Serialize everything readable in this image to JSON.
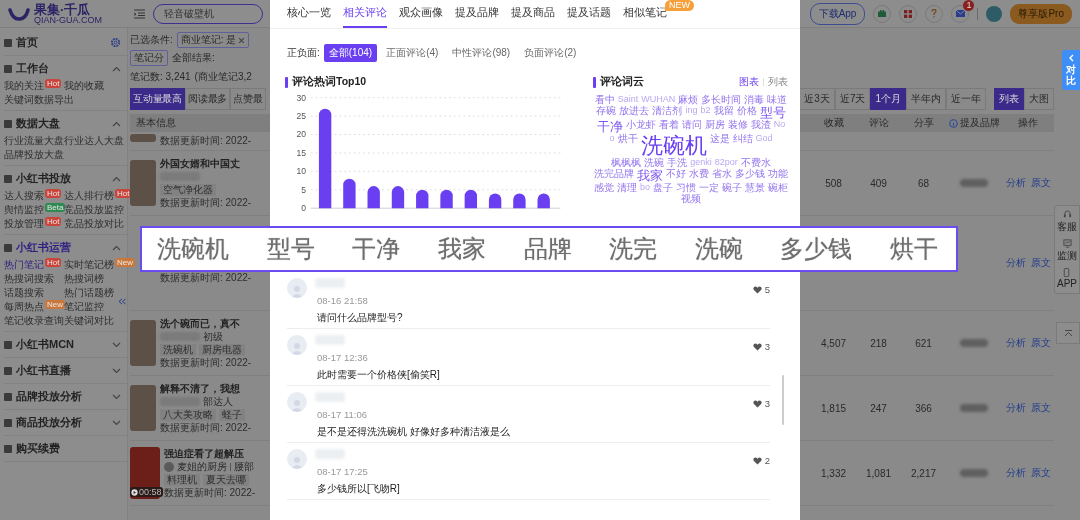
{
  "header": {
    "logo": "果集·千瓜",
    "logo_sub": "QIAN-GUA.COM",
    "search": {
      "placeholder": "轻音破壁机"
    },
    "download": "下载App",
    "message_badge": "1",
    "plan": "尊享版Pro"
  },
  "sidebar": {
    "sections": [
      {
        "label": "首页",
        "kind": "link",
        "selected": false
      },
      {
        "label": "工作台",
        "kind": "group",
        "selected": false,
        "expanded": true,
        "items": [
          {
            "label": "我的关注",
            "selected": false,
            "badge": {
              "text": "Hot",
              "color": "#c9443a"
            }
          },
          {
            "label": "我的收藏",
            "selected": false
          },
          {
            "label": "关键词数据导出",
            "selected": false
          }
        ]
      },
      {
        "label": "数据大盘",
        "kind": "group",
        "selected": false,
        "expanded": true,
        "items": [
          {
            "label": "行业流量大盘",
            "selected": false
          },
          {
            "label": "行业达人大盘",
            "selected": false
          },
          {
            "label": "品牌投放大盘",
            "selected": false
          }
        ]
      },
      {
        "label": "小红书投放",
        "kind": "group",
        "selected": false,
        "expanded": true,
        "items": [
          {
            "label": "达人搜索",
            "selected": false,
            "badge": {
              "text": "Hot",
              "color": "#c9443a"
            }
          },
          {
            "label": "达人排行榜",
            "selected": false,
            "badge": {
              "text": "Hot",
              "color": "#c9443a"
            }
          },
          {
            "label": "舆情监控",
            "selected": false,
            "badge": {
              "text": "Beta",
              "color": "#2f8a52"
            }
          },
          {
            "label": "竞品投放监控",
            "selected": false
          },
          {
            "label": "投放管理",
            "selected": false,
            "badge": {
              "text": "Hot",
              "color": "#c9443a"
            }
          },
          {
            "label": "竞品投放对比",
            "selected": false
          }
        ]
      },
      {
        "label": "小红书运营",
        "kind": "group",
        "selected": true,
        "expanded": true,
        "items": [
          {
            "label": "热门笔记",
            "selected": true,
            "badge": {
              "text": "Hot",
              "color": "#c9443a"
            }
          },
          {
            "label": "实时笔记榜",
            "selected": false,
            "badge": {
              "text": "New",
              "color": "#c9773a"
            }
          },
          {
            "label": "热搜词搜索",
            "selected": false
          },
          {
            "label": "热搜词榜",
            "selected": false
          },
          {
            "label": "话题搜索",
            "selected": false
          },
          {
            "label": "热门话题榜",
            "selected": false
          },
          {
            "label": "每周热点",
            "selected": false,
            "badge": {
              "text": "New",
              "color": "#c9773a"
            }
          },
          {
            "label": "笔记监控",
            "selected": false
          },
          {
            "label": "笔记收录查询",
            "selected": false
          },
          {
            "label": "关键词对比",
            "selected": false
          }
        ]
      },
      {
        "label": "小红书MCN",
        "kind": "group",
        "selected": false,
        "expanded": false
      },
      {
        "label": "小红书直播",
        "kind": "group",
        "selected": false,
        "expanded": false
      },
      {
        "label": "品牌投放分析",
        "kind": "group",
        "selected": false,
        "expanded": false
      },
      {
        "label": "商品投放分析",
        "kind": "group",
        "selected": false,
        "expanded": false
      },
      {
        "label": "购买续费",
        "kind": "link",
        "selected": false
      }
    ]
  },
  "main": {
    "filter_label": "已选条件:",
    "chips": [
      {
        "label": "商业笔记: 是",
        "removable": true
      },
      {
        "label": "笔记分",
        "removable": false
      }
    ],
    "results_label": "全部结果:",
    "results_count": "笔记数: 3,241",
    "results_extra": "(商业笔记3,2",
    "sort_tabs": [
      {
        "label": "互动量最高",
        "selected": true
      },
      {
        "label": "阅读最多",
        "selected": false
      },
      {
        "label": "点赞最",
        "selected": false
      }
    ],
    "ranges": [
      {
        "label": "近3天",
        "selected": false
      },
      {
        "label": "近7天",
        "selected": false
      },
      {
        "label": "1个月",
        "selected": true
      },
      {
        "label": "半年内",
        "selected": false
      },
      {
        "label": "近一年",
        "selected": false
      }
    ],
    "views": [
      {
        "label": "列表",
        "selected": true
      },
      {
        "label": "大图",
        "selected": false
      }
    ],
    "columns": [
      "基本信息",
      "收藏",
      "评论",
      "分享",
      "提及品牌",
      "操作"
    ],
    "rows": [
      {
        "kind": "partial",
        "updated": "数据更新时间: 2022-"
      },
      {
        "kind": "note",
        "title": "外国女婿和中国丈",
        "tags": [
          "空气净化器"
        ],
        "updated": "数据更新时间: 2022-",
        "collects": "508",
        "comments": "409",
        "shares": "68",
        "actions": [
          "分析",
          "原文"
        ]
      },
      {
        "kind": "covered",
        "updated": "数据更新时间: 2022-",
        "actions": [
          "分析",
          "原文"
        ]
      },
      {
        "kind": "note",
        "title": "洗个碗而已，真不",
        "author": "初级",
        "tags": [
          "洗碗机",
          "厨房电器"
        ],
        "updated": "数据更新时间: 2022-",
        "collects": "4,507",
        "comments": "218",
        "shares": "621",
        "actions": [
          "分析",
          "原文"
        ]
      },
      {
        "kind": "note",
        "title": "解释不清了，我想",
        "author": "部达人",
        "tags": [
          "八大美攻略",
          "蛏子"
        ],
        "updated": "数据更新时间: 2022-",
        "collects": "1,815",
        "comments": "247",
        "shares": "366",
        "actions": [
          "分析",
          "原文"
        ]
      },
      {
        "kind": "video",
        "title": "强迫症看了超解压",
        "author": "麦姐的厨房",
        "author_extra": "腰部",
        "duration": "00:58",
        "tags": [
          "料理机",
          "夏天去哪"
        ],
        "updated": "数据更新时间: 2022-",
        "collects": "1,332",
        "comments": "1,081",
        "shares": "2,217",
        "actions": [
          "分析",
          "原文"
        ]
      }
    ]
  },
  "float": {
    "compare": "对比",
    "items": [
      "客服",
      "监测",
      "APP"
    ]
  },
  "modal": {
    "tabs": [
      {
        "label": "核心一览",
        "selected": false
      },
      {
        "label": "相关评论",
        "selected": true
      },
      {
        "label": "观众画像",
        "selected": false
      },
      {
        "label": "提及品牌",
        "selected": false
      },
      {
        "label": "提及商品",
        "selected": false
      },
      {
        "label": "提及话题",
        "selected": false
      },
      {
        "label": "相似笔记",
        "selected": false,
        "badge": "NEW"
      }
    ],
    "sentiment": {
      "label": "正负面:",
      "options": [
        {
          "label": "全部(104)",
          "selected": true
        },
        {
          "label": "正面评论(4)",
          "selected": false
        },
        {
          "label": "中性评论(98)",
          "selected": false
        },
        {
          "label": "负面评论(2)",
          "selected": false
        }
      ]
    },
    "top10": {
      "title": "评论热词Top10",
      "chart_data": {
        "type": "bar",
        "values": [
          27,
          8,
          6,
          6,
          5,
          5,
          5,
          4,
          4,
          4
        ],
        "ylim": [
          0,
          30
        ],
        "yticks": [
          0,
          5,
          10,
          15,
          20,
          25,
          30
        ],
        "grid": true
      }
    },
    "cloud": {
      "title": "评论词云",
      "views": [
        {
          "label": "图表",
          "selected": true
        },
        {
          "label": "列表",
          "selected": false
        }
      ],
      "words": [
        {
          "text": "看中",
          "kind": "minor"
        },
        {
          "text": "Saint",
          "kind": "faint"
        },
        {
          "text": "WUHAN",
          "kind": "faint"
        },
        {
          "text": "麻烦",
          "kind": "minor"
        },
        {
          "text": "多长时间",
          "kind": "minor"
        },
        {
          "text": "消毒",
          "kind": "minor"
        },
        {
          "text": "味道",
          "kind": "minor"
        },
        {
          "text": "存碗",
          "kind": "minor"
        },
        {
          "text": "放进去",
          "kind": "minor"
        },
        {
          "text": "清洁剂",
          "kind": "minor"
        },
        {
          "text": "ing",
          "kind": "faint"
        },
        {
          "text": "b2",
          "kind": "faint"
        },
        {
          "text": "我留",
          "kind": "minor"
        },
        {
          "text": "价格",
          "kind": "minor"
        },
        {
          "text": "型号",
          "kind": "major"
        },
        {
          "text": "干净",
          "kind": "major"
        },
        {
          "text": "小龙虾",
          "kind": "minor"
        },
        {
          "text": "看着",
          "kind": "minor"
        },
        {
          "text": "请问",
          "kind": "minor"
        },
        {
          "text": "厨房",
          "kind": "minor"
        },
        {
          "text": "装修",
          "kind": "minor"
        },
        {
          "text": "我渣",
          "kind": "minor"
        },
        {
          "text": "No",
          "kind": "faint"
        },
        {
          "text": "o",
          "kind": "faint"
        },
        {
          "text": "烘干",
          "kind": "minor"
        },
        {
          "text": "洗碗机",
          "kind": "main"
        },
        {
          "text": "这是",
          "kind": "minor"
        },
        {
          "text": "纠结",
          "kind": "minor"
        },
        {
          "text": "God",
          "kind": "faint"
        },
        {
          "text": "枫枫枫",
          "kind": "minor"
        },
        {
          "text": "洗碗",
          "kind": "minor"
        },
        {
          "text": "手洗",
          "kind": "minor"
        },
        {
          "text": "genki",
          "kind": "faint"
        },
        {
          "text": "82por",
          "kind": "faint"
        },
        {
          "text": "不费水",
          "kind": "minor"
        },
        {
          "text": "洗完品牌",
          "kind": "minor"
        },
        {
          "text": "我家",
          "kind": "major"
        },
        {
          "text": "不好",
          "kind": "minor"
        },
        {
          "text": "水费",
          "kind": "minor"
        },
        {
          "text": "省水",
          "kind": "minor"
        },
        {
          "text": "多少钱",
          "kind": "minor"
        },
        {
          "text": "功能",
          "kind": "minor"
        },
        {
          "text": "感觉",
          "kind": "minor"
        },
        {
          "text": "清理",
          "kind": "minor"
        },
        {
          "text": "bo",
          "kind": "faint"
        },
        {
          "text": "盘子",
          "kind": "minor"
        },
        {
          "text": "习惯",
          "kind": "minor"
        },
        {
          "text": "一定",
          "kind": "minor"
        },
        {
          "text": "碗子",
          "kind": "minor"
        },
        {
          "text": "慧景",
          "kind": "minor"
        },
        {
          "text": "碗柜",
          "kind": "minor"
        },
        {
          "text": "视频",
          "kind": "minor"
        }
      ]
    },
    "comments": [
      {
        "time": "08-16 21:58",
        "likes": "5",
        "text": "请问什么品牌型号?"
      },
      {
        "time": "08-17 12:36",
        "likes": "3",
        "text": "此时需要一个价格侠[偷笑R]"
      },
      {
        "time": "08-17 11:06",
        "likes": "3",
        "text": "是不是还得洗洗碗机 好像好多种清洁液是么"
      },
      {
        "time": "08-17 17:25",
        "likes": "2",
        "text": "多少钱所以[飞吻R]"
      }
    ]
  },
  "zoom_strip": {
    "labels": [
      "洗碗机",
      "型号",
      "干净",
      "我家",
      "品牌",
      "洗完",
      "洗碗",
      "多少钱",
      "烘干"
    ]
  }
}
